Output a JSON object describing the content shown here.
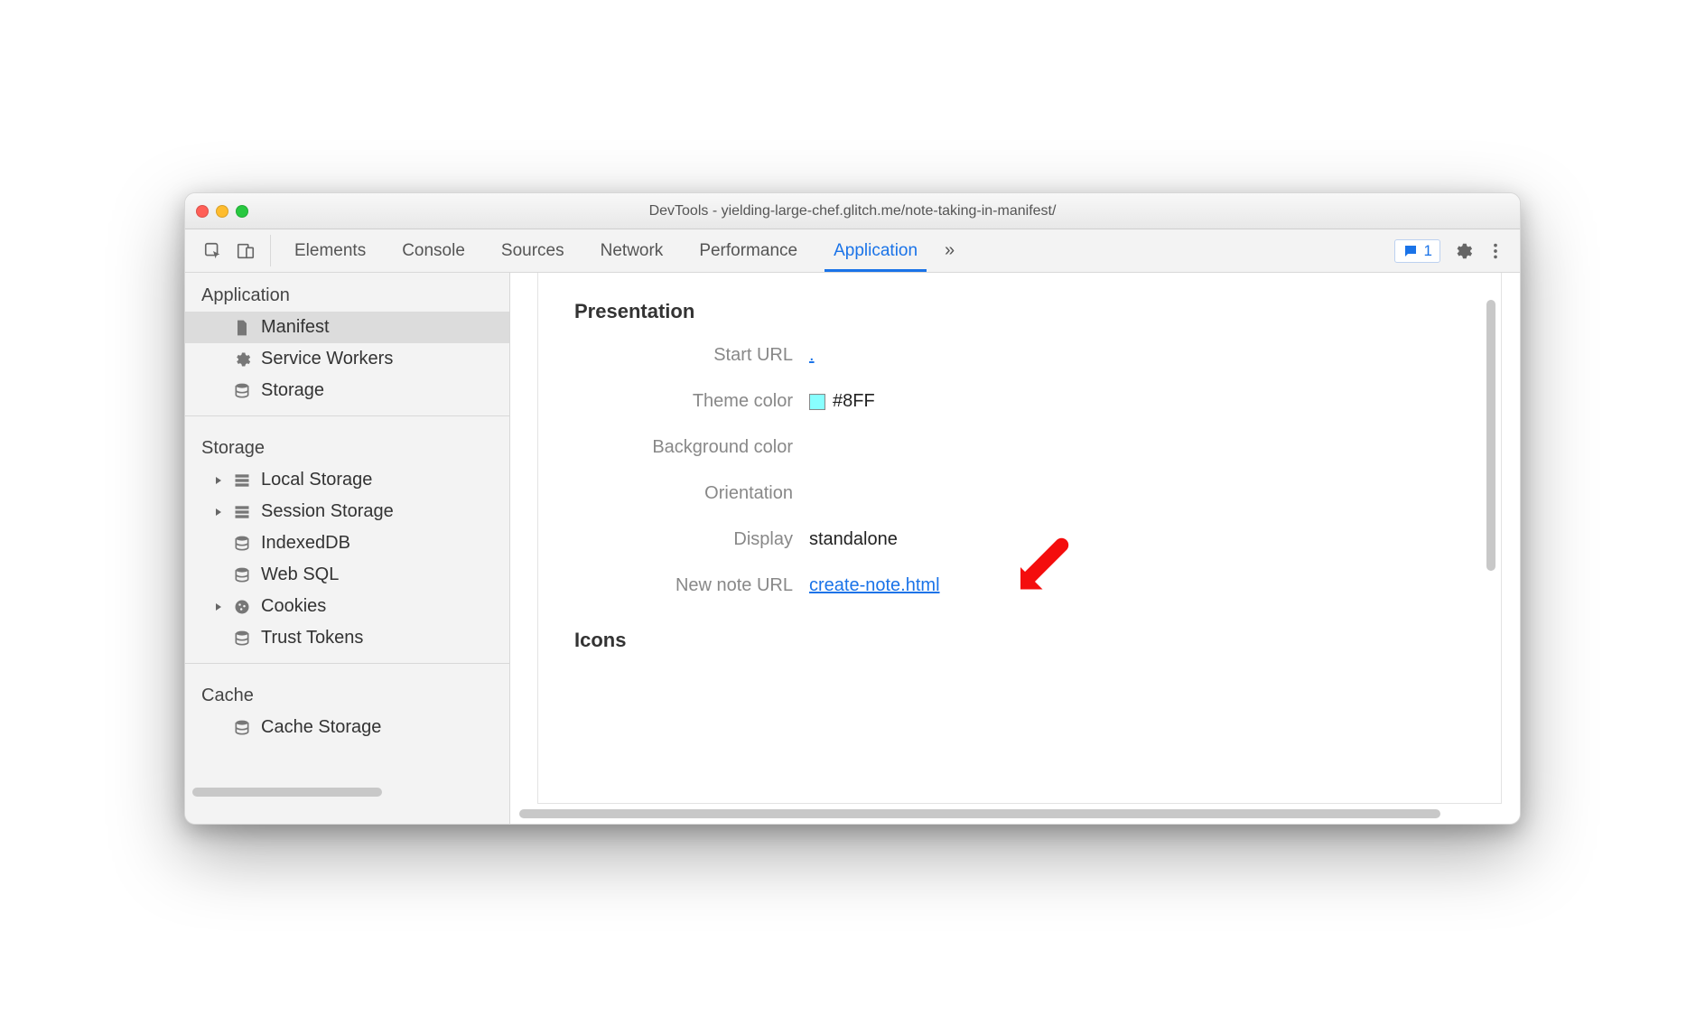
{
  "window": {
    "title": "DevTools - yielding-large-chef.glitch.me/note-taking-in-manifest/"
  },
  "tabs": {
    "items": [
      "Elements",
      "Console",
      "Sources",
      "Network",
      "Performance",
      "Application"
    ],
    "active": "Application",
    "overflow": "»"
  },
  "badge": {
    "count": "1"
  },
  "sidebar": {
    "sections": {
      "application": {
        "title": "Application",
        "items": [
          "Manifest",
          "Service Workers",
          "Storage"
        ]
      },
      "storage": {
        "title": "Storage",
        "items": [
          "Local Storage",
          "Session Storage",
          "IndexedDB",
          "Web SQL",
          "Cookies",
          "Trust Tokens"
        ]
      },
      "cache": {
        "title": "Cache",
        "items": [
          "Cache Storage"
        ]
      }
    }
  },
  "panel": {
    "presentation": {
      "title": "Presentation",
      "start_url_label": "Start URL",
      "start_url_value": ".",
      "theme_color_label": "Theme color",
      "theme_color_value": "#8FF",
      "background_color_label": "Background color",
      "orientation_label": "Orientation",
      "display_label": "Display",
      "display_value": "standalone",
      "new_note_label": "New note URL",
      "new_note_value": "create-note.html"
    },
    "icons_title": "Icons"
  }
}
